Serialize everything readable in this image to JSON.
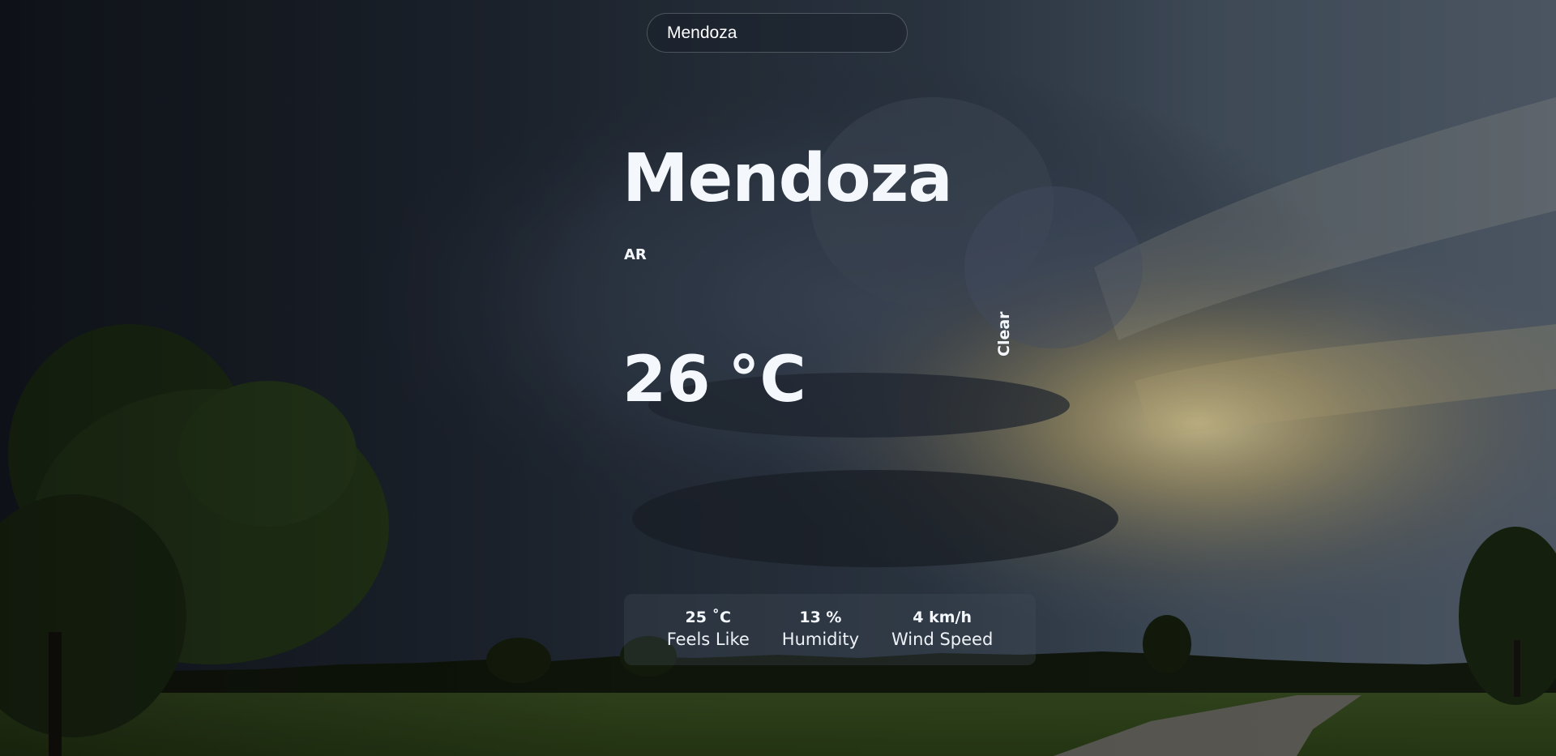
{
  "search": {
    "value": "Mendoza",
    "placeholder": ""
  },
  "weather": {
    "city": "Mendoza",
    "country": "AR",
    "temperature": "26",
    "unit": "°C",
    "condition": "Clear"
  },
  "details": [
    {
      "value": "25 ˚C",
      "label": "Feels Like"
    },
    {
      "value": "13 %",
      "label": "Humidity"
    },
    {
      "value": "4 km/h",
      "label": "Wind Speed"
    }
  ],
  "background": {
    "description_colors": {
      "sky_dark": "#1f2733",
      "storm": "#3a4658",
      "sun": "#d9c58a",
      "grass": "#3f5a23",
      "trees": "#1d2a12"
    }
  }
}
